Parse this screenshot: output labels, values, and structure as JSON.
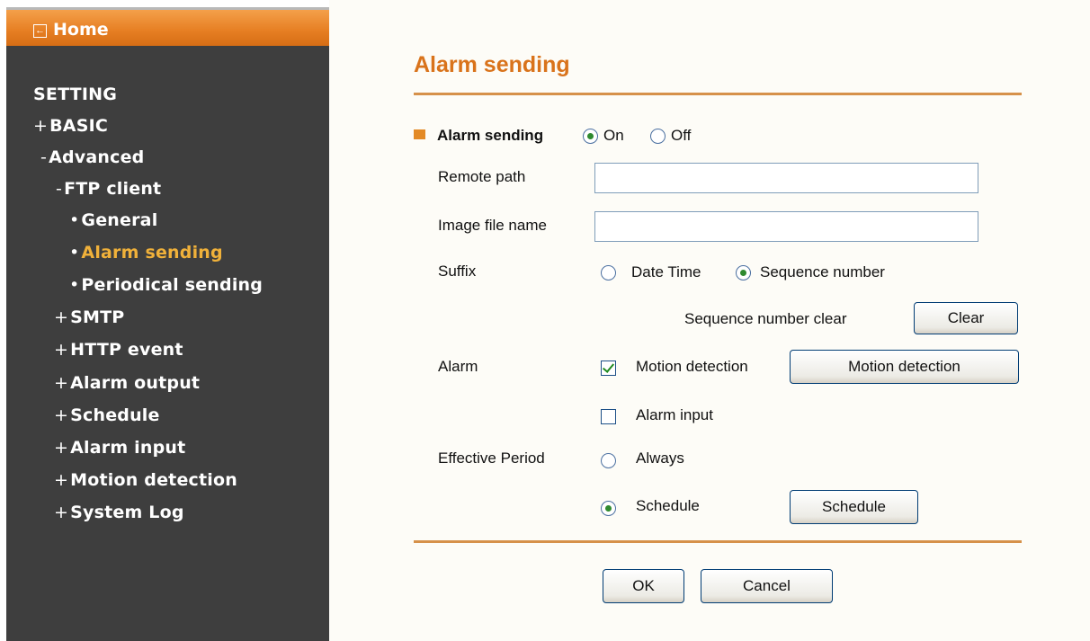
{
  "sidebar": {
    "home_label": "Home",
    "items": [
      {
        "prefix": "",
        "label": "SETTING"
      },
      {
        "prefix": "+",
        "label": "BASIC"
      },
      {
        "prefix": "-",
        "label": "Advanced"
      },
      {
        "prefix": "-",
        "label": "FTP client"
      },
      {
        "prefix": "•",
        "label": "General"
      },
      {
        "prefix": "•",
        "label": "Alarm sending"
      },
      {
        "prefix": "•",
        "label": "Periodical sending"
      },
      {
        "prefix": "+",
        "label": "SMTP"
      },
      {
        "prefix": "+",
        "label": "HTTP event"
      },
      {
        "prefix": "+",
        "label": "Alarm output"
      },
      {
        "prefix": "+",
        "label": "Schedule"
      },
      {
        "prefix": "+",
        "label": "Alarm input"
      },
      {
        "prefix": "+",
        "label": "Motion detection"
      },
      {
        "prefix": "+",
        "label": "System Log"
      }
    ]
  },
  "page": {
    "title": "Alarm sending",
    "alarm_sending_label": "Alarm sending",
    "on_label": "On",
    "off_label": "Off",
    "alarm_sending_value": "On",
    "remote_path_label": "Remote path",
    "remote_path_value": "",
    "image_file_name_label": "Image file name",
    "image_file_name_value": "",
    "suffix_label": "Suffix",
    "suffix_date_time_label": "Date Time",
    "suffix_sequence_label": "Sequence number",
    "suffix_value": "Sequence number",
    "sequence_clear_label": "Sequence number clear",
    "clear_button": "Clear",
    "alarm_label": "Alarm",
    "motion_detection_check_label": "Motion detection",
    "motion_detection_checked": true,
    "motion_detection_button": "Motion detection",
    "alarm_input_check_label": "Alarm input",
    "alarm_input_checked": false,
    "effective_period_label": "Effective Period",
    "always_label": "Always",
    "schedule_radio_label": "Schedule",
    "effective_period_value": "Schedule",
    "schedule_button": "Schedule",
    "ok_button": "OK",
    "cancel_button": "Cancel"
  }
}
